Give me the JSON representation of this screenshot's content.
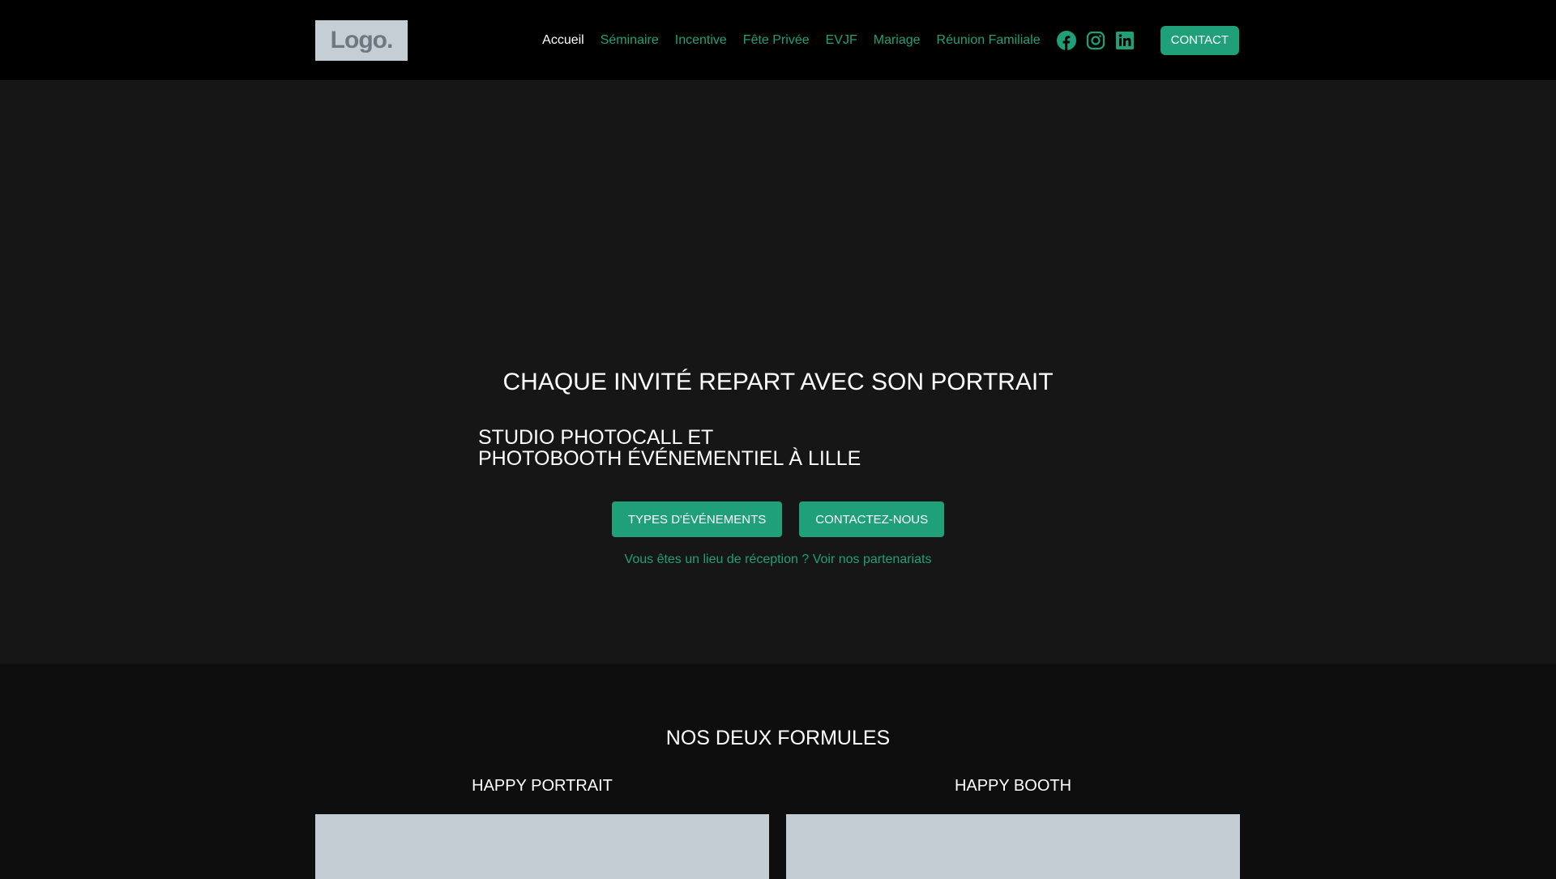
{
  "header": {
    "logo": "Logo.",
    "nav": [
      "Accueil",
      "Séminaire",
      "Incentive",
      "Fête Privée",
      "EVJF",
      "Mariage",
      "Réunion Familiale"
    ],
    "contact": "CONTACT"
  },
  "hero": {
    "title": "CHAQUE INVITÉ REPART AVEC SON PORTRAIT",
    "subtitle_line1": "STUDIO PHOTOCALL ET",
    "subtitle_line2": "PHOTOBOOTH ÉVÉNEMENTIEL À LILLE",
    "btn_events": "TYPES D'ÉVÉNEMENTS",
    "btn_contact": "CONTACTEZ-NOUS",
    "partner_link": "Vous êtes un lieu de réception ? Voir nos partenariats"
  },
  "formules": {
    "title": "NOS DEUX FORMULES",
    "cards": [
      {
        "title": "HAPPY PORTRAIT"
      },
      {
        "title": "HAPPY BOOTH"
      }
    ]
  },
  "colors": {
    "accent": "#1fa078"
  }
}
